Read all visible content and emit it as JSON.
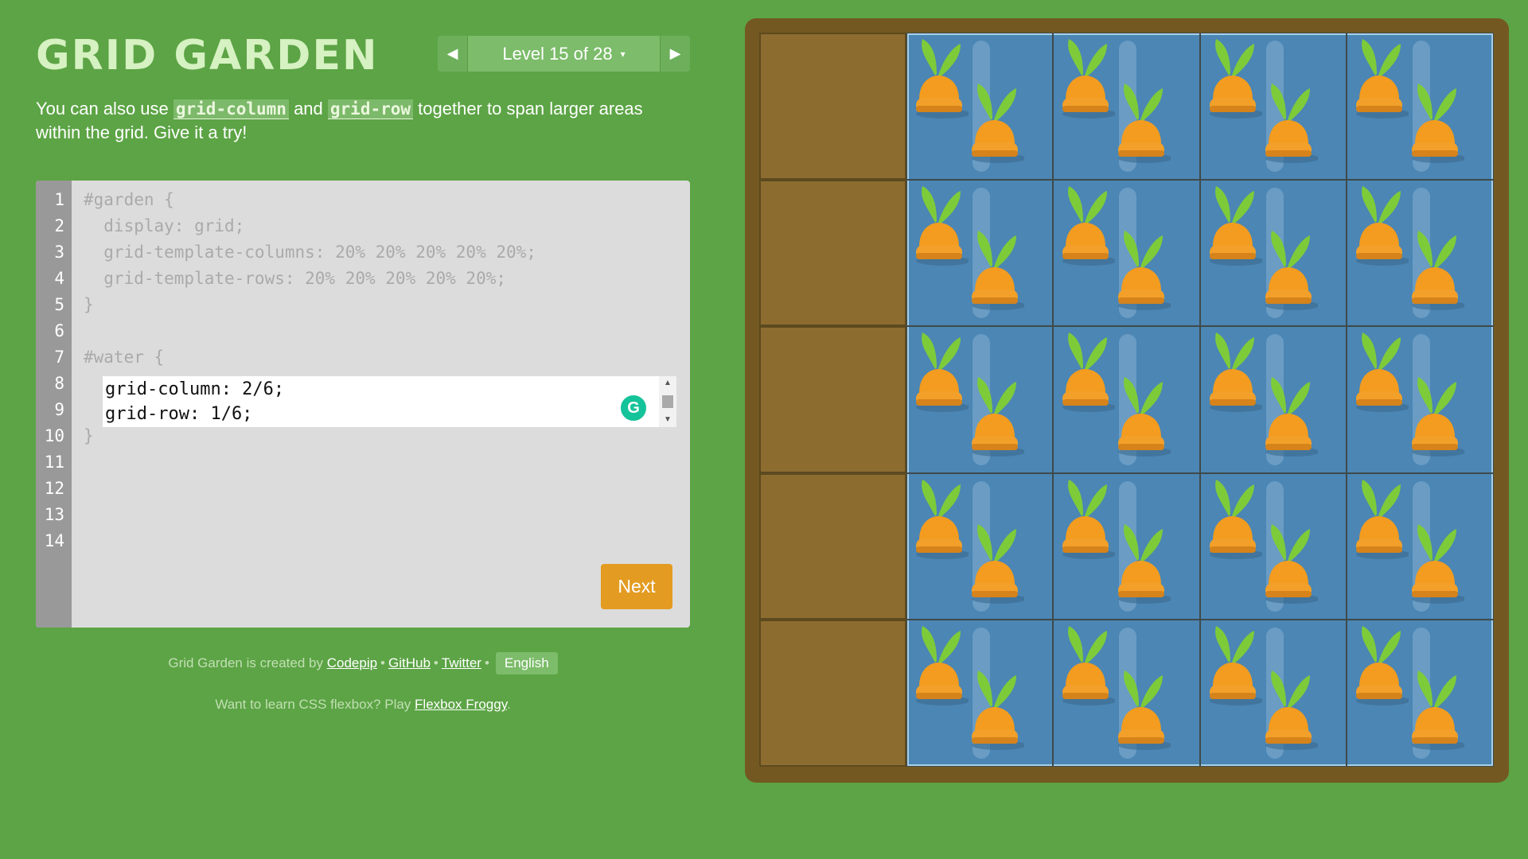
{
  "title": "GRID GARDEN",
  "level": {
    "label": "Level 15 of 28",
    "prev_icon": "◀",
    "next_icon": "▶",
    "caret": "▾"
  },
  "instructions": {
    "part1": "You can also use ",
    "code1": "grid-column",
    "part2": " and ",
    "code2": "grid-row",
    "part3": " together to span larger areas within the grid. Give it a try!"
  },
  "editor": {
    "line_numbers": [
      "1",
      "2",
      "3",
      "4",
      "5",
      "6",
      "7",
      "8",
      "9",
      "10",
      "11",
      "12",
      "13",
      "14"
    ],
    "code_before": [
      "#garden {",
      "  display: grid;",
      "  grid-template-columns: 20% 20% 20% 20% 20%;",
      "  grid-template-rows: 20% 20% 20% 20% 20%;",
      "}",
      "",
      "#water {"
    ],
    "input_lines": [
      "grid-column: 2/6;",
      "grid-row: 1/6;"
    ],
    "code_after": [
      "}"
    ],
    "next_label": "Next",
    "grammarly_icon": "G"
  },
  "footer": {
    "created_by": "Grid Garden is created by ",
    "codepip": "Codepip",
    "github": "GitHub",
    "twitter": "Twitter",
    "bullet": "•",
    "language": "English",
    "learn_text": "Want to learn CSS flexbox? Play ",
    "flexbox_link": "Flexbox Froggy",
    "period": "."
  },
  "colors": {
    "background": "#5ca445",
    "water": "#4b86b4",
    "soil": "#8d6c30",
    "frame": "#745821",
    "next_button": "#e39b21"
  }
}
